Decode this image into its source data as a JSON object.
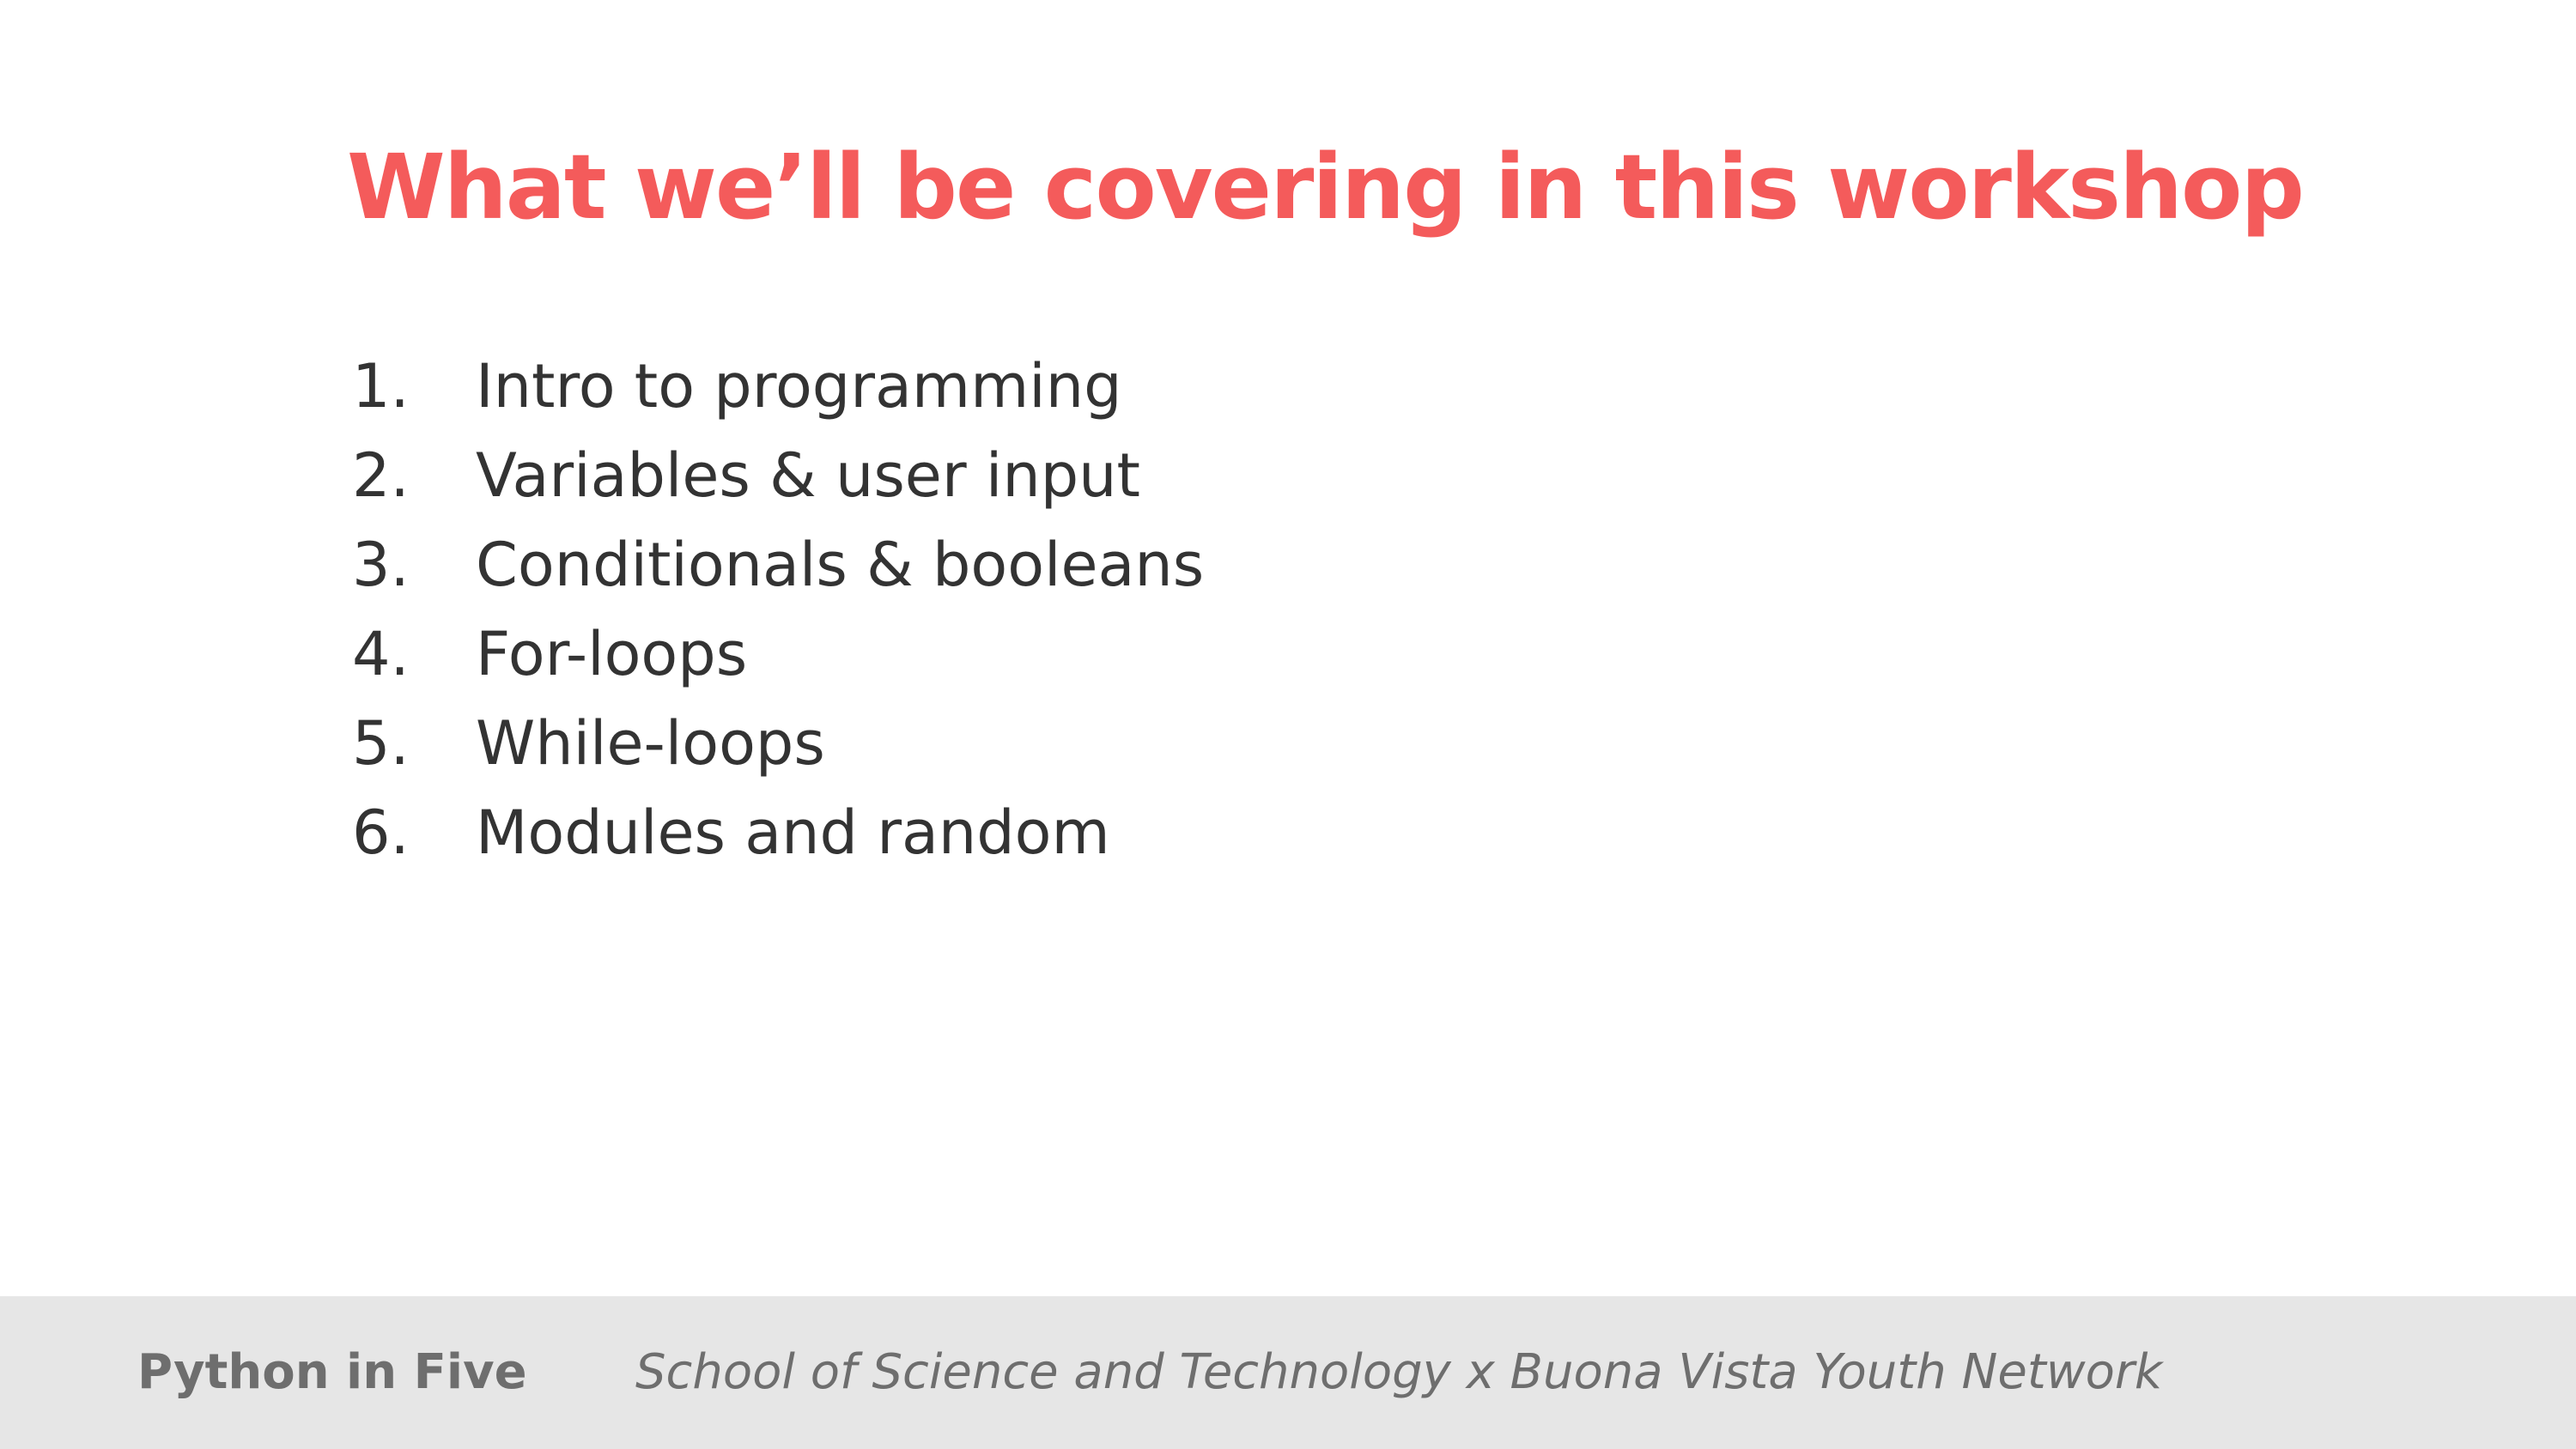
{
  "theme": {
    "accent": "#f45b5b",
    "body_text": "#333333",
    "footer_bg": "#e6e6e6",
    "footer_text": "#6e6e6e"
  },
  "slide": {
    "title": "What we’ll be covering in this workshop",
    "items": [
      {
        "number": "1.",
        "label": "Intro to programming"
      },
      {
        "number": "2.",
        "label": "Variables & user input"
      },
      {
        "number": "3.",
        "label": "Conditionals & booleans"
      },
      {
        "number": "4.",
        "label": "For-loops"
      },
      {
        "number": "5.",
        "label": "While-loops"
      },
      {
        "number": "6.",
        "label": "Modules and random"
      }
    ]
  },
  "footer": {
    "brand": "Python in Five",
    "credit": "School of Science and Technology x Buona Vista Youth Network"
  }
}
